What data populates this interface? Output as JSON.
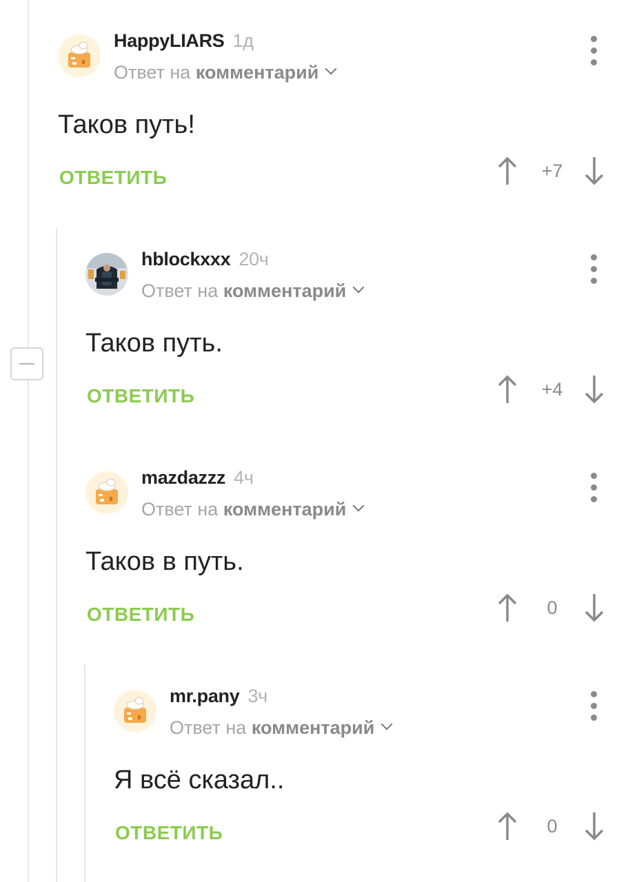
{
  "labels": {
    "reply_prefix": "Ответ на",
    "reply_target": "комментарий",
    "reply_button": "ОТВЕТИТЬ"
  },
  "comments": [
    {
      "username": "HappyLIARS",
      "time": "1д",
      "avatar": "default-cake-avatar",
      "text": "Таков путь!",
      "rating": "+7"
    },
    {
      "username": "hblockxxx",
      "time": "20ч",
      "avatar": "photo-person-in-chair-avatar",
      "text": "Таков путь.",
      "rating": "+4"
    },
    {
      "username": "mazdazzz",
      "time": "4ч",
      "avatar": "default-cake-avatar",
      "text": "Таков в путь.",
      "rating": "0"
    },
    {
      "username": "mr.pany",
      "time": "3ч",
      "avatar": "default-cake-avatar",
      "text": "Я всё сказал..",
      "rating": "0"
    }
  ],
  "icons": {
    "menu": "more-vertical-icon",
    "upvote": "arrow-up-icon",
    "downvote": "arrow-down-icon",
    "expand": "chevron-down-icon",
    "collapse": "minus-icon"
  },
  "colors": {
    "reply_green": "#8bcb4f",
    "avatar_bg": "#fff3dc",
    "avatar_cake": "#f5a94a"
  }
}
